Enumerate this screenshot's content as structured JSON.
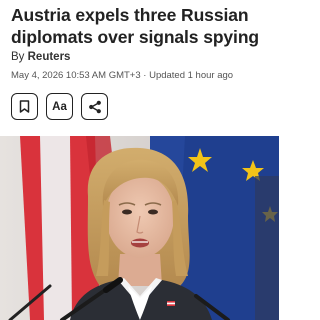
{
  "article": {
    "headline": "Austria expels three Russian diplomats over signals spying",
    "byline_prefix": "By",
    "author": "Reuters",
    "dateline": "May 4, 2026 10:53 AM GMT+3 · Updated 1 hour ago"
  },
  "toolbar": {
    "bookmark_icon": "bookmark-icon",
    "font_size_label": "Aa",
    "share_icon": "share-icon"
  },
  "hero_image": {
    "subject": "woman-speaking-at-microphone",
    "colors": {
      "eu_blue": "#1f3f8f",
      "eu_star": "#f2c318",
      "austria_red": "#d9333c"
    }
  }
}
